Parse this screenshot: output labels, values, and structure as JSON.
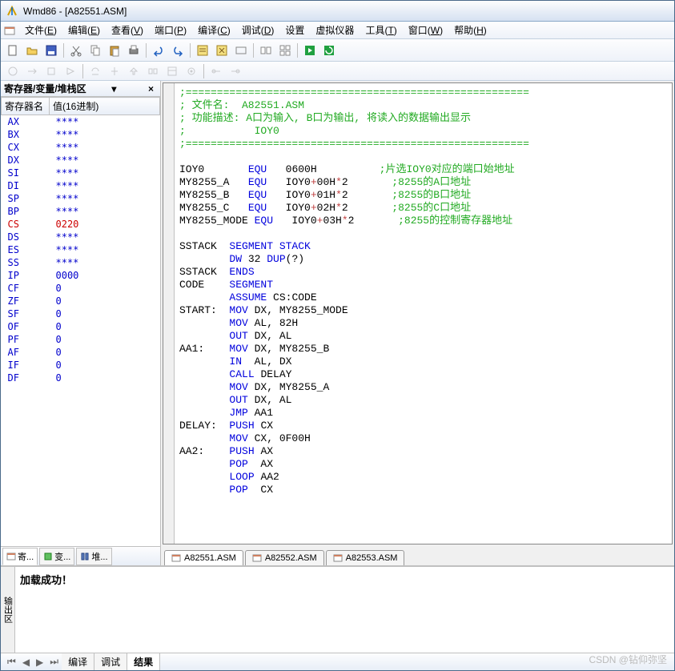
{
  "title": "Wmd86 - [A82551.ASM]",
  "menu": [
    "文件(E)",
    "编辑(E)",
    "查看(V)",
    "端口(P)",
    "编译(C)",
    "调试(D)",
    "设置",
    "虚拟仪器",
    "工具(T)",
    "窗口(W)",
    "帮助(H)"
  ],
  "menu_underline": [
    3,
    3,
    3,
    3,
    3,
    3,
    -1,
    -1,
    3,
    3,
    3
  ],
  "left": {
    "title": "寄存器/变量/堆栈区",
    "col1": "寄存器名",
    "col2": "值(16进制)",
    "regs": [
      {
        "n": "AX",
        "v": "****"
      },
      {
        "n": "BX",
        "v": "****"
      },
      {
        "n": "CX",
        "v": "****"
      },
      {
        "n": "DX",
        "v": "****"
      },
      {
        "n": "SI",
        "v": "****"
      },
      {
        "n": "DI",
        "v": "****"
      },
      {
        "n": "SP",
        "v": "****"
      },
      {
        "n": "BP",
        "v": "****"
      },
      {
        "n": "CS",
        "v": "0220",
        "red": true
      },
      {
        "n": "DS",
        "v": "****"
      },
      {
        "n": "ES",
        "v": "****"
      },
      {
        "n": "SS",
        "v": "****"
      },
      {
        "n": "IP",
        "v": "0000"
      },
      {
        "n": "CF",
        "v": "0"
      },
      {
        "n": "ZF",
        "v": "0"
      },
      {
        "n": "SF",
        "v": "0"
      },
      {
        "n": "OF",
        "v": "0"
      },
      {
        "n": "PF",
        "v": "0"
      },
      {
        "n": "AF",
        "v": "0"
      },
      {
        "n": "IF",
        "v": "0"
      },
      {
        "n": "DF",
        "v": "0"
      }
    ],
    "tabs": [
      "寄...",
      "变...",
      "堆..."
    ]
  },
  "code": [
    {
      "t": ";=======================================================",
      "c": "cm"
    },
    {
      "t": "; 文件名:  A82551.ASM",
      "c": "cm"
    },
    {
      "t": "; 功能描述: A口为输入, B口为输出, 将读入的数据输出显示",
      "c": "cm"
    },
    {
      "t": ";           IOY0",
      "c": "cm"
    },
    {
      "t": ";=======================================================",
      "c": "cm"
    },
    {
      "t": ""
    },
    {
      "parts": [
        [
          "IOY0       ",
          "txt"
        ],
        [
          "EQU",
          "kw"
        ],
        [
          "   0600H          ",
          "txt"
        ],
        [
          ";片选IOY0对应的端口始地址",
          "cm"
        ]
      ]
    },
    {
      "parts": [
        [
          "MY8255_A   ",
          "txt"
        ],
        [
          "EQU",
          "kw"
        ],
        [
          "   IOY0",
          "txt"
        ],
        [
          "+",
          "op"
        ],
        [
          "00H",
          "txt"
        ],
        [
          "*",
          "op"
        ],
        [
          "2       ",
          "txt"
        ],
        [
          ";8255的A口地址",
          "cm"
        ]
      ]
    },
    {
      "parts": [
        [
          "MY8255_B   ",
          "txt"
        ],
        [
          "EQU",
          "kw"
        ],
        [
          "   IOY0",
          "txt"
        ],
        [
          "+",
          "op"
        ],
        [
          "01H",
          "txt"
        ],
        [
          "*",
          "op"
        ],
        [
          "2       ",
          "txt"
        ],
        [
          ";8255的B口地址",
          "cm"
        ]
      ]
    },
    {
      "parts": [
        [
          "MY8255_C   ",
          "txt"
        ],
        [
          "EQU",
          "kw"
        ],
        [
          "   IOY0",
          "txt"
        ],
        [
          "+",
          "op"
        ],
        [
          "02H",
          "txt"
        ],
        [
          "*",
          "op"
        ],
        [
          "2       ",
          "txt"
        ],
        [
          ";8255的C口地址",
          "cm"
        ]
      ]
    },
    {
      "parts": [
        [
          "MY8255_MODE ",
          "txt"
        ],
        [
          "EQU",
          "kw"
        ],
        [
          "   IOY0",
          "txt"
        ],
        [
          "+",
          "op"
        ],
        [
          "03H",
          "txt"
        ],
        [
          "*",
          "op"
        ],
        [
          "2       ",
          "txt"
        ],
        [
          ";8255的控制寄存器地址",
          "cm"
        ]
      ]
    },
    {
      "t": ""
    },
    {
      "parts": [
        [
          "SSTACK  ",
          "txt"
        ],
        [
          "SEGMENT STACK",
          "kw"
        ]
      ]
    },
    {
      "parts": [
        [
          "        ",
          "txt"
        ],
        [
          "DW",
          "kw"
        ],
        [
          " 32 ",
          "txt"
        ],
        [
          "DUP",
          "kw"
        ],
        [
          "(?)",
          "txt"
        ]
      ]
    },
    {
      "parts": [
        [
          "SSTACK  ",
          "txt"
        ],
        [
          "ENDS",
          "kw"
        ]
      ]
    },
    {
      "parts": [
        [
          "CODE    ",
          "txt"
        ],
        [
          "SEGMENT",
          "kw"
        ]
      ]
    },
    {
      "parts": [
        [
          "        ",
          "txt"
        ],
        [
          "ASSUME",
          "kw"
        ],
        [
          " CS:CODE",
          "txt"
        ]
      ]
    },
    {
      "parts": [
        [
          "START:  ",
          "txt"
        ],
        [
          "MOV",
          "kw"
        ],
        [
          " DX, MY8255_MODE",
          "txt"
        ]
      ]
    },
    {
      "parts": [
        [
          "        ",
          "txt"
        ],
        [
          "MOV",
          "kw"
        ],
        [
          " AL, 82H",
          "txt"
        ]
      ]
    },
    {
      "parts": [
        [
          "        ",
          "txt"
        ],
        [
          "OUT",
          "kw"
        ],
        [
          " DX, AL",
          "txt"
        ]
      ]
    },
    {
      "parts": [
        [
          "AA1:    ",
          "txt"
        ],
        [
          "MOV",
          "kw"
        ],
        [
          " DX, MY8255_B",
          "txt"
        ]
      ]
    },
    {
      "parts": [
        [
          "        ",
          "txt"
        ],
        [
          "IN",
          "kw"
        ],
        [
          "  AL, DX",
          "txt"
        ]
      ]
    },
    {
      "parts": [
        [
          "        ",
          "txt"
        ],
        [
          "CALL",
          "kw"
        ],
        [
          " DELAY",
          "txt"
        ]
      ]
    },
    {
      "parts": [
        [
          "        ",
          "txt"
        ],
        [
          "MOV",
          "kw"
        ],
        [
          " DX, MY8255_A",
          "txt"
        ]
      ]
    },
    {
      "parts": [
        [
          "        ",
          "txt"
        ],
        [
          "OUT",
          "kw"
        ],
        [
          " DX, AL",
          "txt"
        ]
      ]
    },
    {
      "parts": [
        [
          "        ",
          "txt"
        ],
        [
          "JMP",
          "kw"
        ],
        [
          " AA1",
          "txt"
        ]
      ]
    },
    {
      "parts": [
        [
          "DELAY:  ",
          "txt"
        ],
        [
          "PUSH",
          "kw"
        ],
        [
          " CX",
          "txt"
        ]
      ]
    },
    {
      "parts": [
        [
          "        ",
          "txt"
        ],
        [
          "MOV",
          "kw"
        ],
        [
          " CX, 0F00H",
          "txt"
        ]
      ]
    },
    {
      "parts": [
        [
          "AA2:    ",
          "txt"
        ],
        [
          "PUSH",
          "kw"
        ],
        [
          " AX",
          "txt"
        ]
      ]
    },
    {
      "parts": [
        [
          "        ",
          "txt"
        ],
        [
          "POP",
          "kw"
        ],
        [
          "  AX",
          "txt"
        ]
      ]
    },
    {
      "parts": [
        [
          "        ",
          "txt"
        ],
        [
          "LOOP",
          "kw"
        ],
        [
          " AA2",
          "txt"
        ]
      ]
    },
    {
      "parts": [
        [
          "        ",
          "txt"
        ],
        [
          "POP",
          "kw"
        ],
        [
          "  CX",
          "txt"
        ]
      ]
    }
  ],
  "file_tabs": [
    "A82551.ASM",
    "A82552.ASM",
    "A82553.ASM"
  ],
  "active_file_tab": 0,
  "output": {
    "vtab": "输出区",
    "text": "加载成功！"
  },
  "bottom_tabs": [
    "编译",
    "调试",
    "结果"
  ],
  "active_bottom_tab": 2,
  "watermark": "CSDN @钻仰弥坚"
}
